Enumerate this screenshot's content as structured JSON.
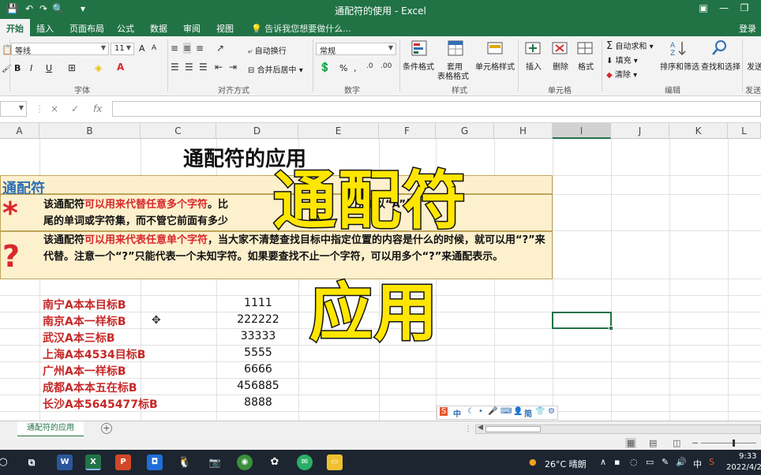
{
  "window": {
    "title": "通配符的使用 - Excel",
    "login": "登录"
  },
  "tabs": [
    "开始",
    "插入",
    "页面布局",
    "公式",
    "数据",
    "审阅",
    "视图"
  ],
  "tell_me": "告诉我您想要做什么...",
  "ribbon": {
    "font_name": "等线",
    "font_size": "11",
    "number_format": "常规",
    "wrap_text": "自动换行",
    "merge_center": "合并后居中",
    "percent": "%",
    "comma": ",",
    "bold": "B",
    "italic": "I",
    "underline": "U",
    "font_grow": "A",
    "font_shrink": "A",
    "cond_format": "条件格式",
    "table_format_1": "套用",
    "table_format_2": "表格格式",
    "cell_style": "单元格样式",
    "insert": "插入",
    "delete": "删除",
    "format": "格式",
    "autosum": "自动求和",
    "fill": "填充",
    "clear": "清除",
    "sort_filter": "排序和筛选",
    "find_select": "查找和选择",
    "send": "发送",
    "groups": {
      "font": "字体",
      "alignment": "对齐方式",
      "number": "数字",
      "styles": "样式",
      "cells": "单元格",
      "editing": "编辑",
      "send": "发送"
    }
  },
  "formula_bar": {
    "fx": "fx",
    "cancel": "×",
    "enter": "✓"
  },
  "columns": [
    "A",
    "B",
    "C",
    "D",
    "E",
    "F",
    "G",
    "H",
    "I",
    "J",
    "K",
    "L"
  ],
  "sheet": {
    "title": "通配符的应用",
    "header_label": "通配符",
    "star": {
      "symbol": "*",
      "pre": "该通配符",
      "highlight": "可以用来代替任意多个字符",
      "mid": "。比",
      "mid2": "所有以“A”结",
      "line2": "尾的单词或字符集，而不管它前面有多少"
    },
    "question": {
      "symbol": "?",
      "pre": "该通配符",
      "highlight": "可以用来代表任意单个字符",
      "rest": "，当大家不清楚查找目标中指定位置的内容是什么的时候，就可以用“?”来代替。注意一个“?”只能代表一个未知字符。如果要查找不止一个字符，可以用多个“?”来通配表示。"
    },
    "rows": [
      {
        "name": "南宁A本本目标B",
        "value": "1111"
      },
      {
        "name": "南京A本一样标B",
        "value": "222222"
      },
      {
        "name": "武汉A本三标B",
        "value": "33333"
      },
      {
        "name": "上海A本4534目标B",
        "value": "5555"
      },
      {
        "name": "广州A本一样标B",
        "value": "6666"
      },
      {
        "name": "成都A本本五在标B",
        "value": "456885"
      },
      {
        "name": "长沙A本5645477标B",
        "value": "8888"
      }
    ]
  },
  "overlay": {
    "line1": "通配符",
    "line2": "应用"
  },
  "ime": {
    "lang": "中",
    "simp": "简"
  },
  "sheet_tab": "通配符的应用",
  "taskbar": {
    "weather": "26°C 晴朗",
    "ime": "中",
    "time": "9:33",
    "date": "2022/4/2"
  }
}
